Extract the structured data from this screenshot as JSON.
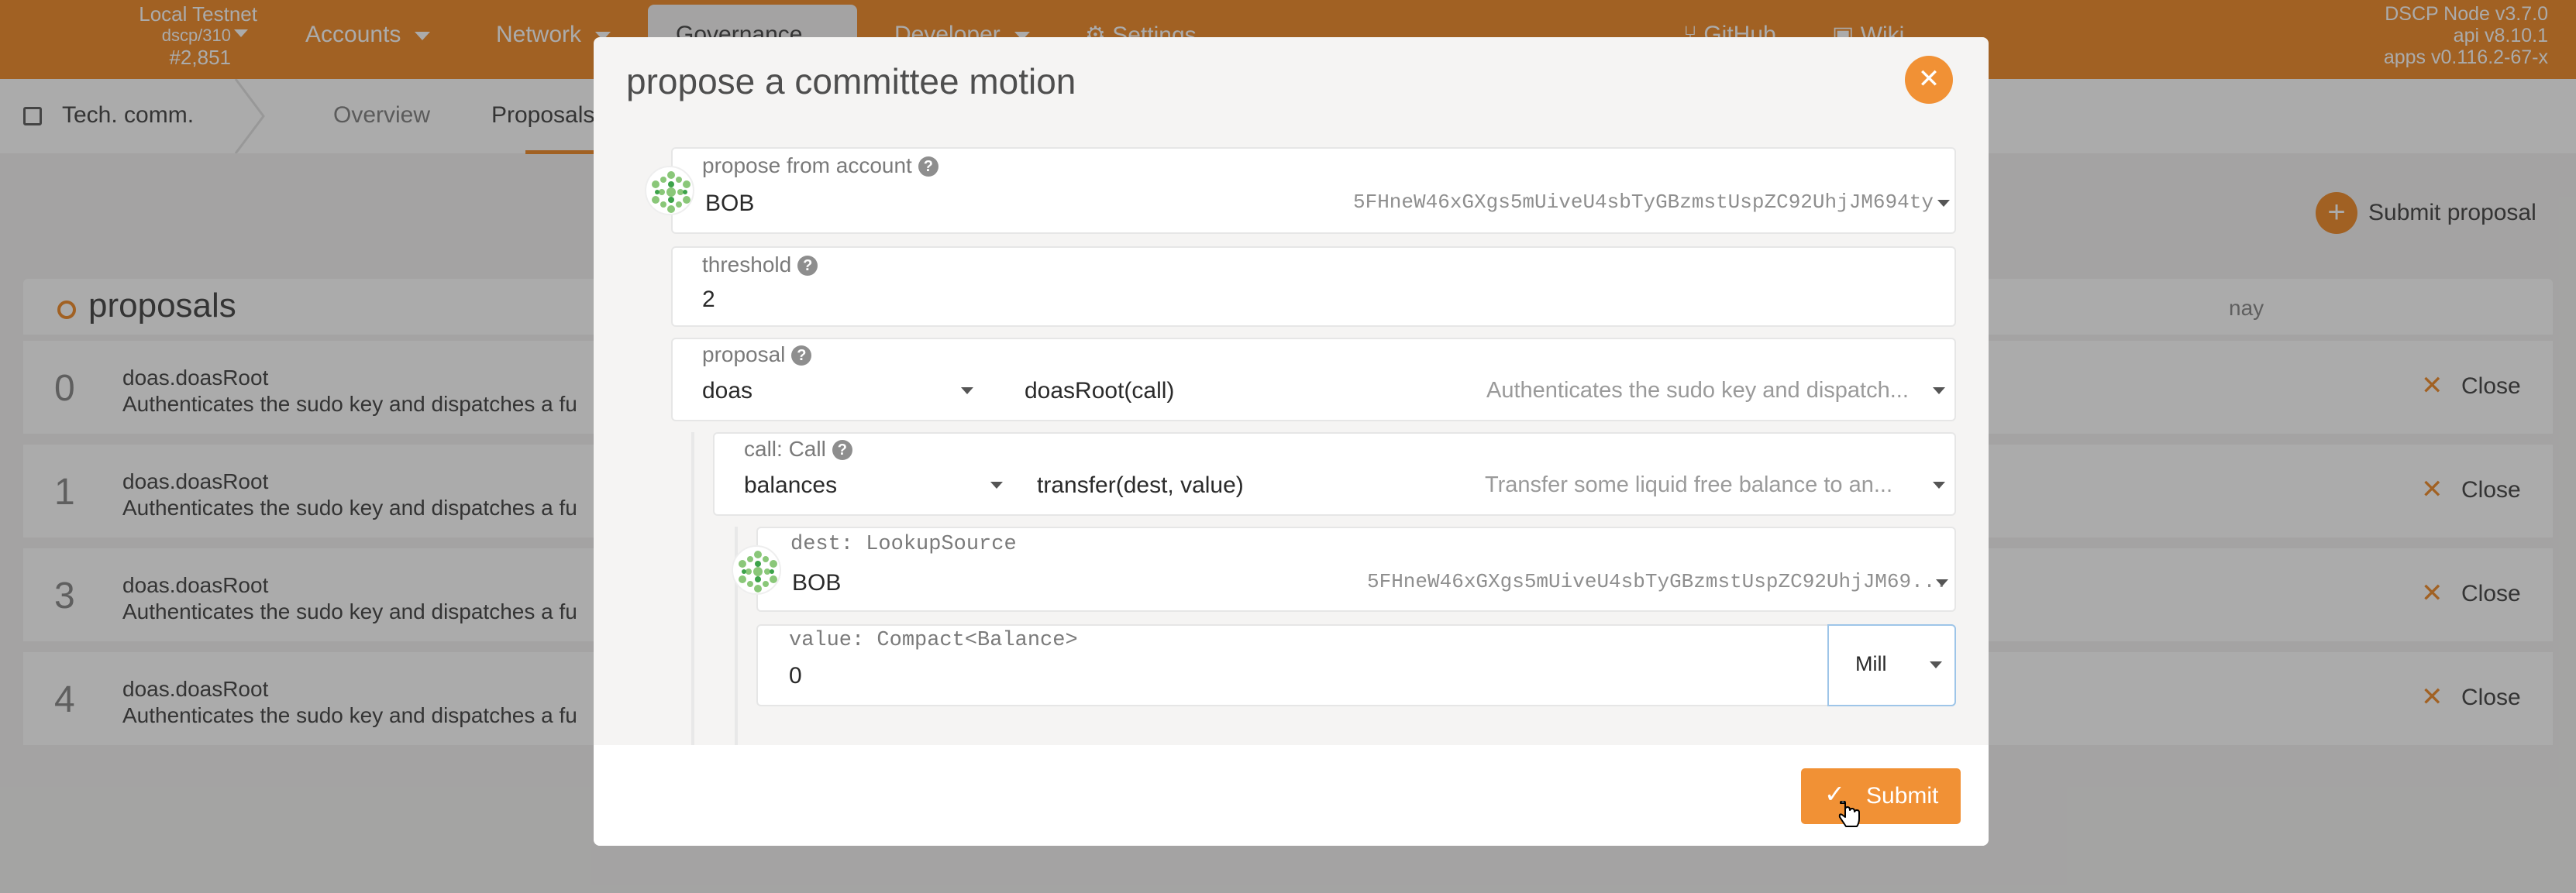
{
  "topbar": {
    "chain_name": "Local Testnet",
    "chain_spec": "dscp/310",
    "block": "#2,851",
    "menu": [
      {
        "label": "Accounts"
      },
      {
        "label": "Network"
      },
      {
        "label": "Governance"
      },
      {
        "label": "Developer"
      },
      {
        "label": "Settings"
      }
    ],
    "links": [
      {
        "label": "GitHub"
      },
      {
        "label": "Wiki"
      }
    ],
    "version": {
      "node": "DSCP Node v3.7.0",
      "api": "api v8.10.1",
      "apps": "apps v0.116.2-67-x"
    }
  },
  "subnav": {
    "section": "Tech. comm.",
    "tabs": [
      {
        "label": "Overview"
      },
      {
        "label": "Proposals"
      }
    ]
  },
  "content": {
    "submit_proposal": "Submit proposal",
    "table_title": "proposals",
    "col_nay": "nay",
    "close_label": "Close",
    "rows": [
      {
        "index": "0",
        "call": "doas.doasRoot",
        "desc": "Authenticates the sudo key and dispatches a fu"
      },
      {
        "index": "1",
        "call": "doas.doasRoot",
        "desc": "Authenticates the sudo key and dispatches a fu"
      },
      {
        "index": "3",
        "call": "doas.doasRoot",
        "desc": "Authenticates the sudo key and dispatches a fu"
      },
      {
        "index": "4",
        "call": "doas.doasRoot",
        "desc": "Authenticates the sudo key and dispatches a fu"
      }
    ]
  },
  "modal": {
    "title": "propose a committee motion",
    "account": {
      "label": "propose from account",
      "name": "BOB",
      "address": "5FHneW46xGXgs5mUiveU4sbTyGBzmstUspZC92UhjJM694ty"
    },
    "threshold": {
      "label": "threshold",
      "value": "2"
    },
    "proposal": {
      "label": "proposal",
      "section": "doas",
      "method": "doasRoot(call)",
      "hint": "Authenticates the sudo key and dispatch..."
    },
    "call": {
      "label": "call: Call",
      "section": "balances",
      "method": "transfer(dest, value)",
      "hint": "Transfer some liquid free balance to an..."
    },
    "dest": {
      "label": "dest: LookupSource",
      "name": "BOB",
      "address": "5FHneW46xGXgs5mUiveU4sbTyGBzmstUspZC92UhjJM69..."
    },
    "value": {
      "label": "value: Compact<Balance>",
      "amount": "0",
      "unit": "Mill"
    },
    "submit": "Submit",
    "help_glyph": "?"
  }
}
